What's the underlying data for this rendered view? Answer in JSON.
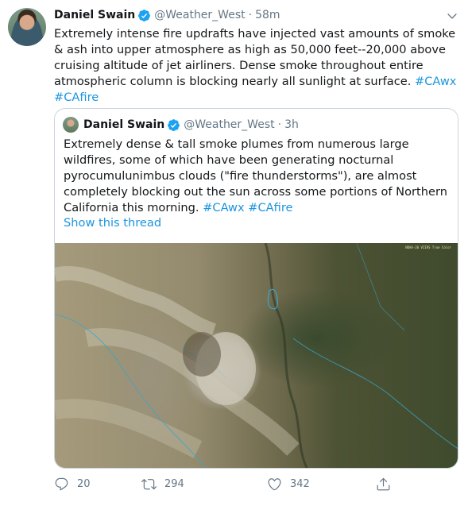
{
  "tweet": {
    "author_name": "Daniel Swain",
    "author_handle": "@Weather_West",
    "separator": "·",
    "time": "58m",
    "text_plain": "Extremely intense fire updrafts have injected vast amounts of smoke & ash into upper atmosphere as high as 50,000 feet--20,000 above cruising altitude of jet airliners. Dense smoke throughout entire atmospheric column is blocking nearly all sunlight at surface.",
    "hashtag1": "#CAwx",
    "hashtag2": "#CAfire"
  },
  "quoted": {
    "author_name": "Daniel Swain",
    "author_handle": "@Weather_West",
    "separator": "·",
    "time": "3h",
    "text_plain": "Extremely dense & tall smoke plumes from numerous large wildfires, some of which have been generating nocturnal pyrocumulunimbus clouds (\"fire thunderstorms\"), are almost completely blocking out the sun across some portions of Northern California this morning.",
    "hashtag1": "#CAwx",
    "hashtag2": "#CAfire",
    "show_thread": "Show this thread",
    "media_label": "NOAA-20 VIIRS True Color"
  },
  "actions": {
    "reply_count": "20",
    "retweet_count": "294",
    "like_count": "342"
  },
  "icons": {
    "verified": "verified-badge-icon",
    "caret": "chevron-down-icon",
    "reply": "reply-icon",
    "retweet": "retweet-icon",
    "like": "heart-icon",
    "share": "share-icon"
  },
  "colors": {
    "link": "#1b95e0",
    "muted": "#657786",
    "border": "#ccd6dd"
  }
}
